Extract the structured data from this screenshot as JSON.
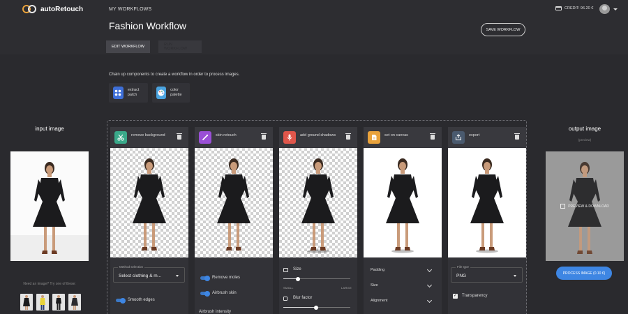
{
  "app": {
    "brand": "autoRetouch"
  },
  "header": {
    "nav": "MY WORKFLOWS",
    "title": "Fashion Workflow",
    "save_label": "SAVE WORKFLOW",
    "credit": "CREDIT: 96.20 €"
  },
  "tabs": [
    {
      "label": "EDIT WORKFLOW",
      "active": true
    },
    {
      "label": "RUN WORKFLOW",
      "active": false
    }
  ],
  "intro": "Chain up components to create a workflow in order to process images.",
  "components": [
    {
      "label": "extract patch",
      "icon": "grid-icon",
      "color": "#3e6fd8"
    },
    {
      "label": "color palette",
      "icon": "palette-icon",
      "color": "#4aa3df"
    }
  ],
  "input": {
    "title": "input image",
    "need_text": "Need an image? Try one of these:"
  },
  "steps": [
    {
      "label": "remove background",
      "icon": "scissors-icon",
      "color": "#3aa98a"
    },
    {
      "label": "skin retouch",
      "icon": "brush-icon",
      "color": "#9a4fd6"
    },
    {
      "label": "add ground shadows",
      "icon": "shadow-icon",
      "color": "#e0564b"
    },
    {
      "label": "set on canvas",
      "icon": "canvas-icon",
      "color": "#e9a23b"
    },
    {
      "label": "export",
      "icon": "export-icon",
      "color": "#4a5a6e"
    }
  ],
  "controls": {
    "method_label": "Method selection",
    "method_value": "Select clothing & m...",
    "smooth_edges": "Smooth edges",
    "remove_moles": "Remove moles",
    "airbrush_skin": "Airbrush skin",
    "airbrush_intensity": "Airbrush intensity",
    "size_label": "Size",
    "small": "SMALL",
    "large": "LARGE",
    "blur_factor": "Blur factor",
    "padding": "Padding",
    "size": "Size",
    "alignment": "Alignment",
    "file_type_label": "File type",
    "file_type_value": "PNG",
    "transparency": "Transparency"
  },
  "output": {
    "title": "output image",
    "subtitle": "(preview)",
    "download": "PREVIEW & DOWNLOAD",
    "process": "PROCESS IMAGE (0.10 €)"
  }
}
